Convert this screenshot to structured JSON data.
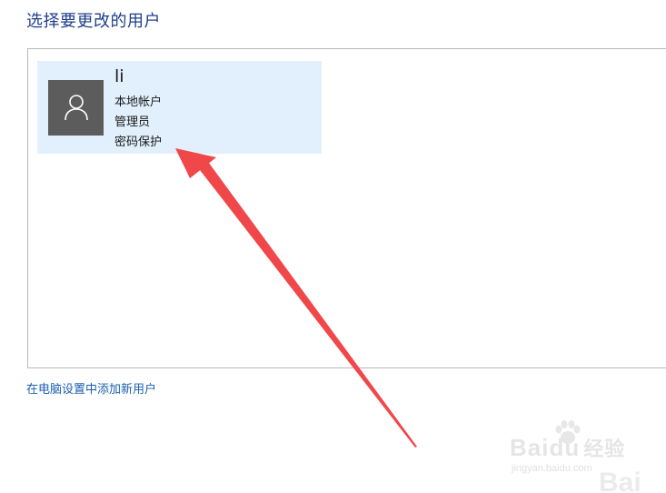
{
  "header": {
    "title": "选择要更改的用户"
  },
  "user_list": {
    "users": [
      {
        "name": "li",
        "account_type": "本地帐户",
        "role": "管理员",
        "protection": "密码保护",
        "avatar_icon": "user-silhouette-icon"
      }
    ]
  },
  "footer": {
    "add_user_link": "在电脑设置中添加新用户"
  },
  "annotation": {
    "arrow_color": "#f0474a",
    "arrow_icon": "red-arrow-icon"
  },
  "watermark": {
    "logo": "Bai",
    "logo_du": "du",
    "logo_cn": "经验",
    "url": "jingyan.baidu.com",
    "big_text": "Bai"
  },
  "colors": {
    "title": "#1e3f8c",
    "tile_bg": "#e1f0fc",
    "avatar_bg": "#5c5c5c",
    "link": "#1a5fb4",
    "border": "#b9b9b9"
  }
}
